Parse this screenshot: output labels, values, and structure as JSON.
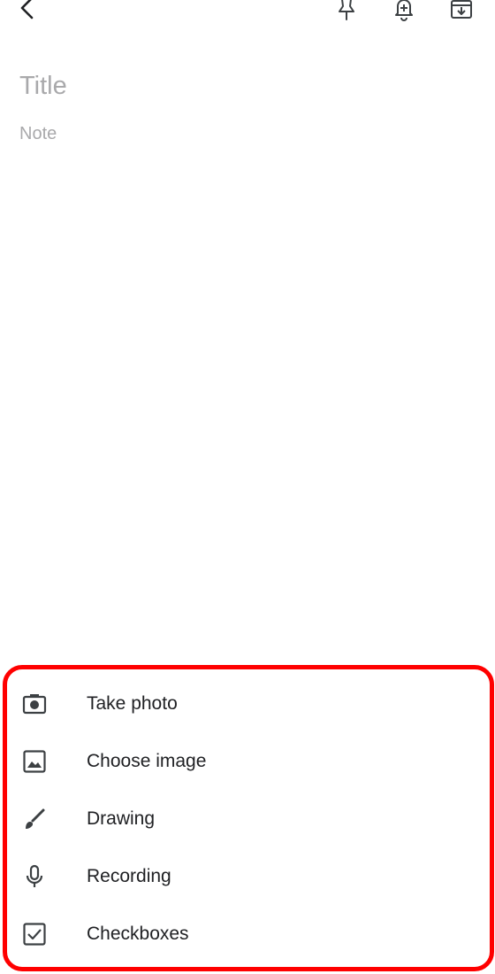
{
  "toolbar": {
    "back_icon": "chevron-left-icon",
    "pin_icon": "pin-icon",
    "reminder_icon": "add-alert-icon",
    "archive_icon": "archive-icon"
  },
  "note": {
    "title_placeholder": "Title",
    "body_placeholder": "Note"
  },
  "add_menu": {
    "highlight_color": "#ff0000",
    "items": [
      {
        "label": "Take photo",
        "icon": "camera-icon"
      },
      {
        "label": "Choose image",
        "icon": "image-icon"
      },
      {
        "label": "Drawing",
        "icon": "brush-icon"
      },
      {
        "label": "Recording",
        "icon": "microphone-icon"
      },
      {
        "label": "Checkboxes",
        "icon": "checkbox-icon"
      }
    ]
  }
}
